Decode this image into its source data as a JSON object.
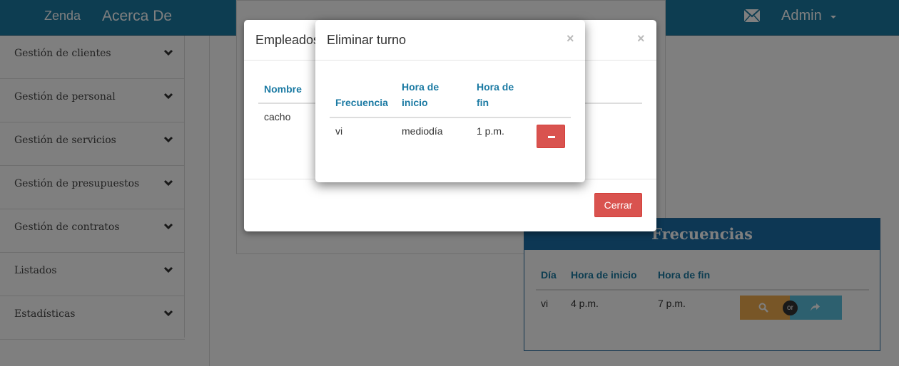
{
  "navbar": {
    "brand": "Zenda",
    "link_about": "Acerca De",
    "user": "Admin",
    "mail_icon": "envelope-icon"
  },
  "sidebar": {
    "items": [
      {
        "label": "Gestión de clientes"
      },
      {
        "label": "Gestión de personal"
      },
      {
        "label": "Gestión de servicios"
      },
      {
        "label": "Gestión de presupuestos"
      },
      {
        "label": "Gestión de contratos"
      },
      {
        "label": "Listados"
      },
      {
        "label": "Estadísticas"
      }
    ]
  },
  "frecuencias": {
    "title": "Frecuencias",
    "headers": [
      "Día",
      "Hora de inicio",
      "Hora de fin"
    ],
    "row": {
      "dia": "vi",
      "inicio": "4 p.m.",
      "fin": "7 p.m."
    },
    "or_label": "or",
    "colors": {
      "search": "#f0ad4e",
      "share": "#5bc0de"
    }
  },
  "modal_empleados": {
    "title": "Empleados",
    "header": "Nombre",
    "row": "cacho",
    "close_button": "Cerrar"
  },
  "modal_eliminar": {
    "title": "Eliminar turno",
    "headers": {
      "frecuencia": "Frecuencia",
      "inicio_1": "Hora de",
      "inicio_2": "inicio",
      "fin_1": "Hora de",
      "fin_2": "fin"
    },
    "row": {
      "frecuencia": "vi",
      "inicio": "mediodía",
      "fin": "1 p.m."
    },
    "close_symbol": "×"
  },
  "colors": {
    "navbar": "#1b7aa3",
    "accent_text": "#1b7aa3",
    "danger": "#d9534f"
  }
}
